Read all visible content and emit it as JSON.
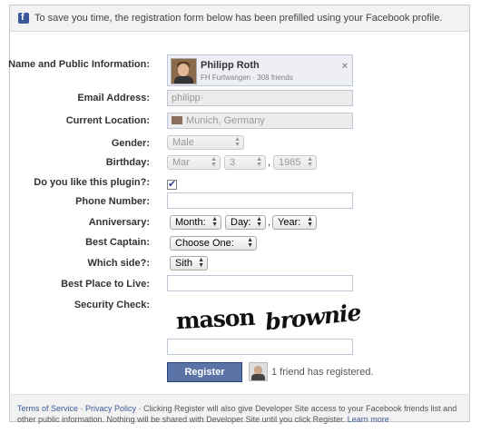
{
  "notice": {
    "text": "To save you time, the registration form below has been prefilled using your Facebook profile."
  },
  "labels": {
    "name_public": "Name and Public Information:",
    "email": "Email Address:",
    "location": "Current Location:",
    "gender": "Gender:",
    "birthday": "Birthday:",
    "plugin": "Do you like this plugin?:",
    "phone": "Phone Number:",
    "anniversary": "Anniversary:",
    "captain": "Best Captain:",
    "side": "Which side?:",
    "place": "Best Place to Live:",
    "security": "Security Check:"
  },
  "profile": {
    "name": "Philipp Roth",
    "subtitle": "FH Furtwangen · 308 friends",
    "close": "×"
  },
  "email": {
    "value": "philipp·"
  },
  "location": {
    "value": "Munich, Germany"
  },
  "gender": {
    "value": "Male"
  },
  "birthday": {
    "month": "Mar",
    "day": "3",
    "year": "1985"
  },
  "plugin": {
    "checked": true
  },
  "phone": {
    "value": ""
  },
  "anniversary": {
    "month": "Month:",
    "day": "Day:",
    "year": "Year:"
  },
  "captain": {
    "value": "Choose One:"
  },
  "side": {
    "value": "Sith"
  },
  "place": {
    "value": ""
  },
  "captcha": {
    "word1": "mason",
    "word2": "brownie",
    "answer": ""
  },
  "register": {
    "button": "Register",
    "friends_text": "1 friend has registered."
  },
  "footer": {
    "terms": "Terms of Service",
    "sep": " · ",
    "privacy": "Privacy Policy",
    "body": " · Clicking Register will also give Developer Site access to your Facebook friends list and other public information. Nothing will be shared with Developer Site until you click Register. ",
    "learn_more": "Learn more"
  }
}
